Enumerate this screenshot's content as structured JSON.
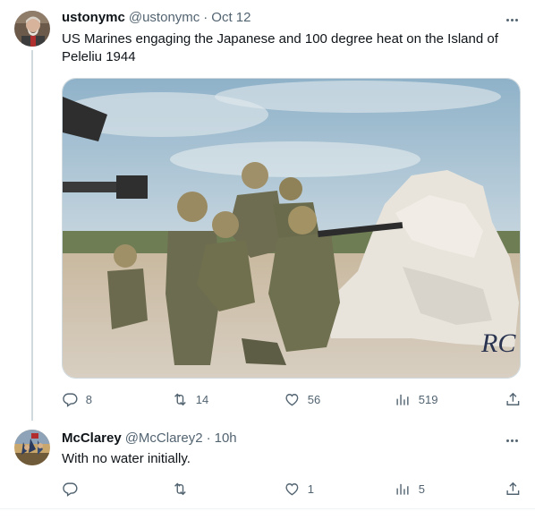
{
  "tweets": [
    {
      "name": "ustonymc",
      "handle": "@ustonymc",
      "dot": "·",
      "time": "Oct 12",
      "text_lines": [
        "US Marines engaging the Japanese and 100 degree heat on the Island of",
        "Peleliu 1944"
      ],
      "media_icon": "photo-of-marines-on-peleliu",
      "watermark": "RC",
      "stats": {
        "replies": "8",
        "retweets": "14",
        "likes": "56",
        "views": "519"
      }
    },
    {
      "name": "McClarey",
      "handle": "@McClarey2",
      "dot": "·",
      "time": "10h",
      "text": "With no water initially.",
      "stats": {
        "replies": "",
        "retweets": "",
        "likes": "1",
        "views": "5"
      }
    }
  ],
  "icons": {
    "reply": "reply-icon",
    "retweet": "retweet-icon",
    "like": "heart-icon",
    "views": "views-icon",
    "share": "share-icon",
    "more": "more-icon"
  },
  "colors": {
    "text": "#0f1419",
    "muted": "#536471",
    "line": "#cfd9de"
  }
}
